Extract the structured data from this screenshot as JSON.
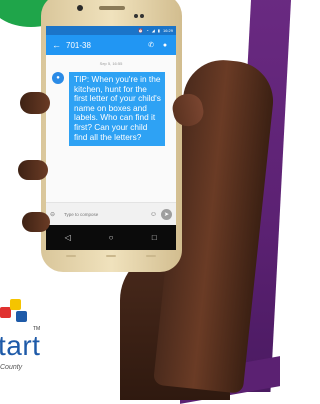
{
  "status_bar": {
    "time": "16:29",
    "icons": [
      "alarm-icon",
      "wifi-icon",
      "signal-icon",
      "battery-icon"
    ]
  },
  "appbar": {
    "back_icon": "arrow-left-icon",
    "title": "701-38",
    "call_icon": "phone-icon",
    "contact_icon": "person-icon"
  },
  "conversation": {
    "date": "Sep 5, 16:55",
    "messages": [
      {
        "sender_icon": "person-icon",
        "text": "TIP: When you're in the kitchen, hunt for the first letter of your child's name on boxes and labels. Who can find it first? Can your child find all the letters?"
      }
    ]
  },
  "composer": {
    "placeholder": "Type to compose",
    "attach_icon": "attach-icon",
    "emoji_icon": "smiley-icon",
    "send_icon": "send-icon"
  },
  "navbar": {
    "back_icon": "triangle-back-icon",
    "home_icon": "circle-home-icon",
    "recent_icon": "square-recents-icon"
  },
  "brand": {
    "wordmark": "tart",
    "tm": "TM",
    "subtitle": "County",
    "colors": {
      "red": "#e0312f",
      "yellow": "#f5c400",
      "blue": "#1e5aa8",
      "green": "#1fa54a",
      "purple": "#5b2172"
    }
  }
}
